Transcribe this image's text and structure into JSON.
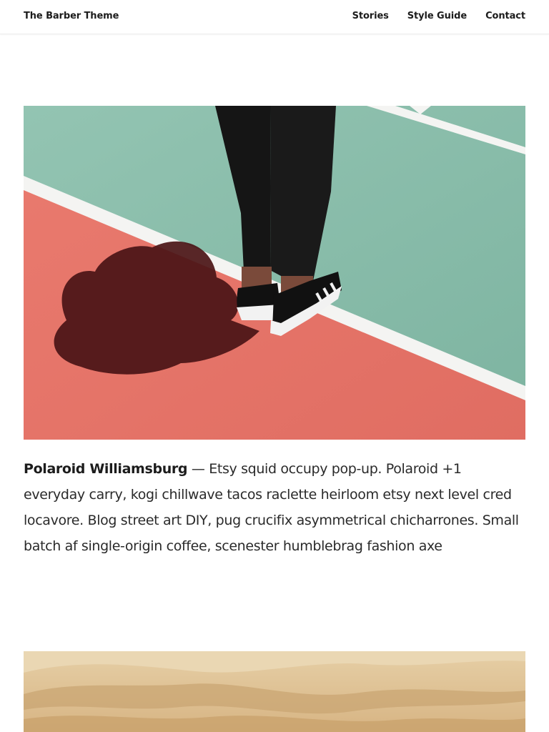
{
  "header": {
    "site_title": "The Barber Theme",
    "nav": [
      {
        "label": "Stories"
      },
      {
        "label": "Style Guide"
      },
      {
        "label": "Contact"
      }
    ]
  },
  "posts": [
    {
      "title": "Polaroid Williamsburg",
      "separator": " — ",
      "excerpt": "Etsy squid occupy pop-up. Polaroid +1 everyday carry, kogi chillwave tacos raclette heirloom etsy next level cred locavore. Blog street art DIY, pug crucifix asymmetrical chicharrones. Small batch af single-origin coffee, scenester humblebrag fashion axe",
      "image_subject": "sneakers-on-court-photo"
    },
    {
      "image_subject": "sand-dunes-photo"
    }
  ],
  "colors": {
    "court_green": "#8fbfae",
    "court_red": "#e5756a",
    "court_line": "#ffffff",
    "sand": "#e3c497"
  }
}
